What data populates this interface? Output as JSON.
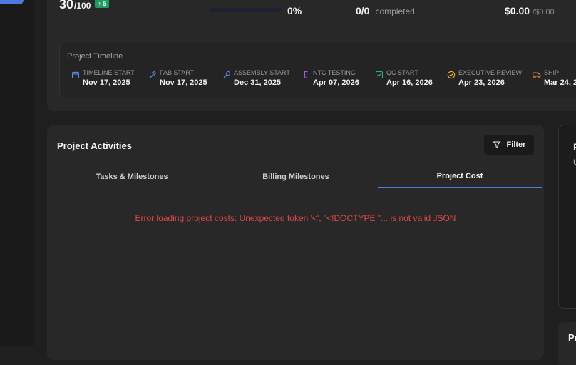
{
  "summary": {
    "score": "30",
    "score_denominator": "/100",
    "score_delta": "5",
    "progress_fraction": 0,
    "progress_percent": "0%",
    "tasks_count": "0/0",
    "tasks_label": "completed",
    "cost_value": "$0.00",
    "cost_budget": "/$0.00"
  },
  "timeline": {
    "title": "Project Timeline",
    "items": [
      {
        "label": "TIMELINE START",
        "date": "Nov 17, 2025",
        "icon": "calendar-icon",
        "color": "#5b8def"
      },
      {
        "label": "FAB START",
        "date": "Nov 17, 2025",
        "icon": "hammer-icon",
        "color": "#5b8def"
      },
      {
        "label": "ASSEMBLY START",
        "date": "Dec 31, 2025",
        "icon": "wrench-icon",
        "color": "#5b8def"
      },
      {
        "label": "NTC TESTING",
        "date": "Apr 07, 2026",
        "icon": "test-tube-icon",
        "color": "#a259e6"
      },
      {
        "label": "QC START",
        "date": "Apr 16, 2026",
        "icon": "check-square-icon",
        "color": "#2bb673"
      },
      {
        "label": "EXECUTIVE REVIEW",
        "date": "Apr 23, 2026",
        "icon": "check-circle-icon",
        "color": "#e6b422"
      },
      {
        "label": "SHIP",
        "date": "Mar 24, 2",
        "icon": "truck-icon",
        "color": "#e8833a"
      }
    ]
  },
  "activities": {
    "title": "Project Activities",
    "filter_label": "Filter",
    "tabs": [
      {
        "label": "Tasks & Milestones"
      },
      {
        "label": "Billing Milestones"
      },
      {
        "label": "Project Cost"
      }
    ],
    "active_tab": "Project Cost",
    "error": "Error loading project costs: Unexpected token '<', \"<!DOCTYPE \"... is not valid JSON"
  },
  "right_panel": {
    "heading_fragment": "P",
    "sub_fragment": "U",
    "lower_heading_fragment": "Pr"
  },
  "colors": {
    "accent": "#4c7ae0",
    "success": "#1c9e63",
    "error": "#e04848"
  }
}
